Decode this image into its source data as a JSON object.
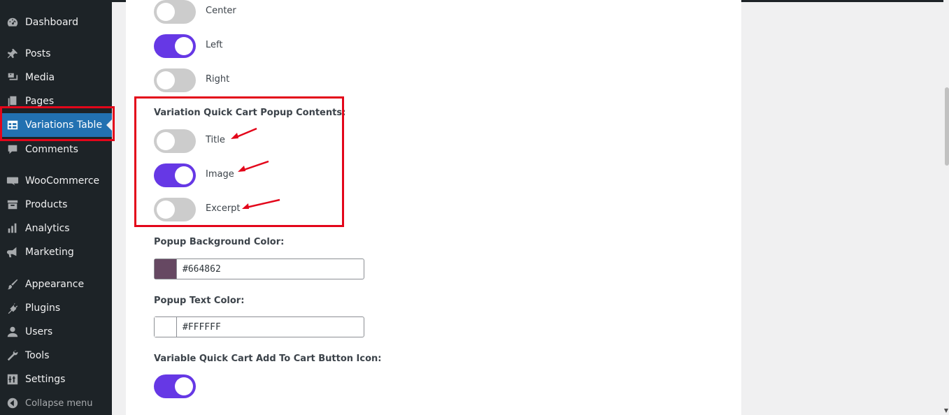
{
  "sidebar": {
    "items": [
      {
        "label": "Dashboard",
        "icon": "dashboard-icon"
      },
      {
        "label": "Posts",
        "icon": "pin-icon"
      },
      {
        "label": "Media",
        "icon": "media-icon"
      },
      {
        "label": "Pages",
        "icon": "pages-icon"
      },
      {
        "label": "Variations Table",
        "icon": "table-icon",
        "active": true
      },
      {
        "label": "Comments",
        "icon": "comment-icon"
      },
      {
        "label": "WooCommerce",
        "icon": "woo-icon"
      },
      {
        "label": "Products",
        "icon": "archive-icon"
      },
      {
        "label": "Analytics",
        "icon": "chart-bar-icon"
      },
      {
        "label": "Marketing",
        "icon": "megaphone-icon"
      },
      {
        "label": "Appearance",
        "icon": "brush-icon"
      },
      {
        "label": "Plugins",
        "icon": "plug-icon"
      },
      {
        "label": "Users",
        "icon": "user-icon"
      },
      {
        "label": "Tools",
        "icon": "wrench-icon"
      },
      {
        "label": "Settings",
        "icon": "sliders-icon"
      }
    ],
    "collapse_label": "Collapse menu",
    "active_color": "#2271b1",
    "background_color": "#1d2327"
  },
  "alignment": {
    "options": [
      {
        "label": "Center",
        "on": false
      },
      {
        "label": "Left",
        "on": true
      },
      {
        "label": "Right",
        "on": false
      }
    ]
  },
  "popup_contents": {
    "heading": "Variation Quick Cart Popup Contents:",
    "options": [
      {
        "label": "Title",
        "on": false
      },
      {
        "label": "Image",
        "on": true
      },
      {
        "label": "Excerpt",
        "on": false
      }
    ]
  },
  "popup_background": {
    "label": "Popup Background Color:",
    "value": "#664862",
    "swatch": "#664862"
  },
  "popup_text": {
    "label": "Popup Text Color:",
    "value": "#FFFFFF",
    "swatch": "#FFFFFF"
  },
  "add_to_cart_icon": {
    "label": "Variable Quick Cart Add To Cart Button Icon:",
    "on": true
  },
  "toggle_on_color": "#6638e5",
  "annotation_color": "#e3061a"
}
